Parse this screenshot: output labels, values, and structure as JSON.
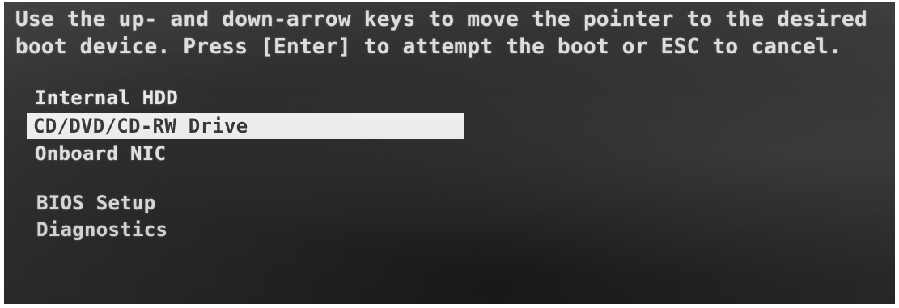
{
  "instructions": {
    "line1": "Use the up- and down-arrow keys to move the pointer to the desired",
    "line2": "boot device. Press [Enter] to attempt the boot or ESC to cancel."
  },
  "boot_devices": [
    {
      "label": "Internal HDD",
      "selected": false
    },
    {
      "label": "CD/DVD/CD-RW Drive",
      "selected": true
    },
    {
      "label": "Onboard NIC",
      "selected": false
    }
  ],
  "other_options": [
    {
      "label": "BIOS Setup"
    },
    {
      "label": "Diagnostics"
    }
  ],
  "colors": {
    "background": "#2a2a2a",
    "text": "#e8e8e8",
    "highlight_background": "#f2f2f2",
    "highlight_text": "#3a3a3a"
  }
}
